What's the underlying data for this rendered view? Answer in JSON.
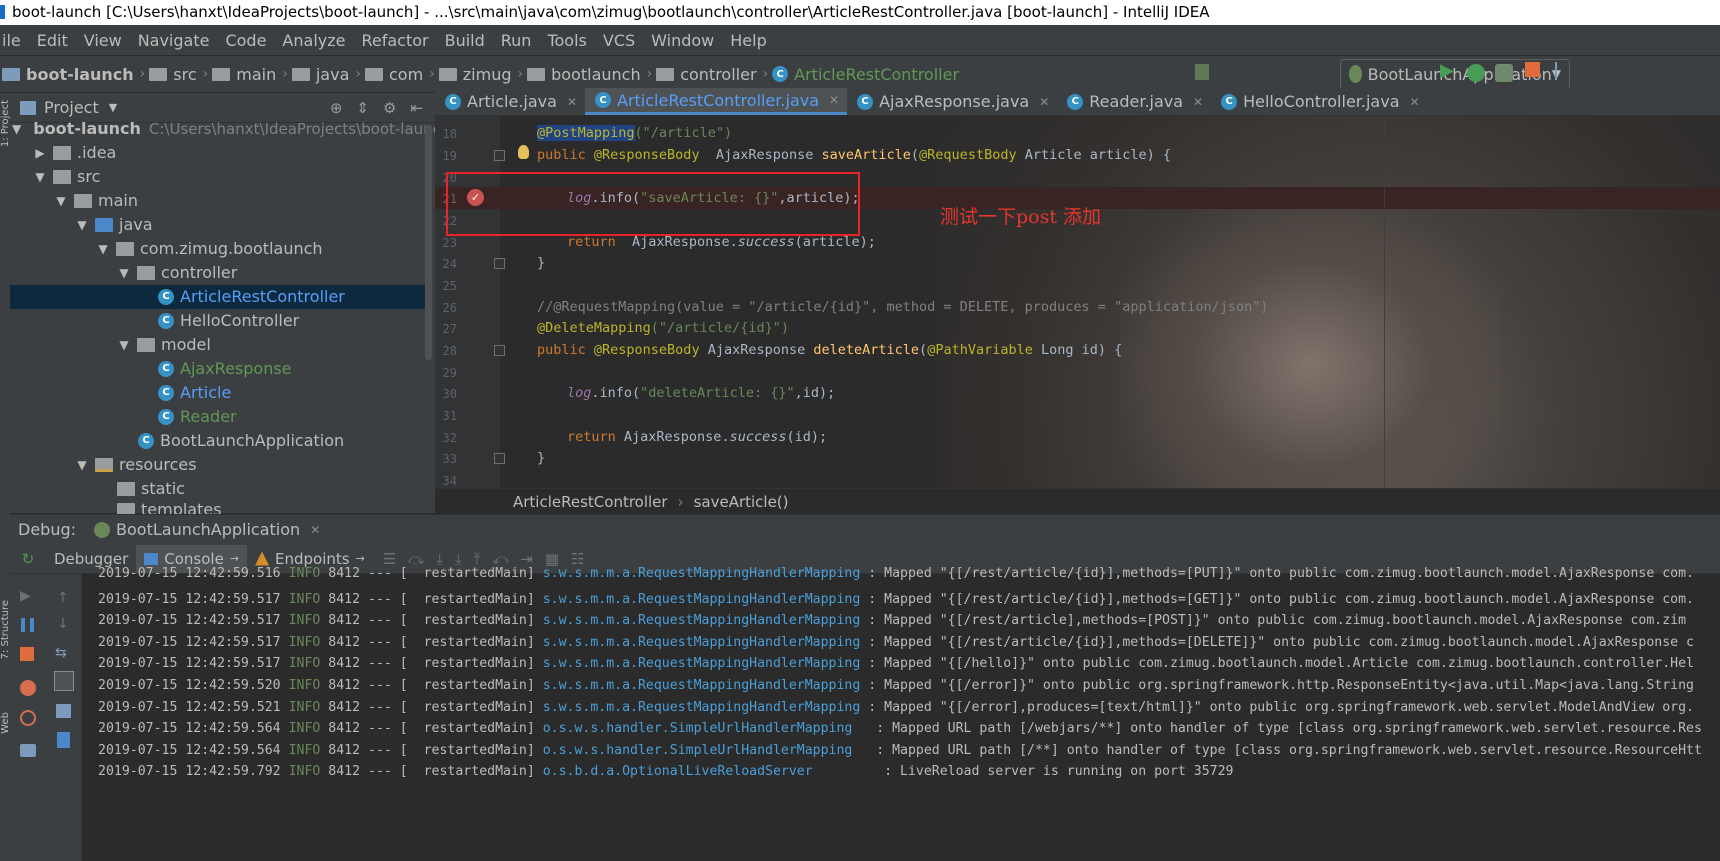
{
  "window_title": "boot-launch [C:\\Users\\hanxt\\IdeaProjects\\boot-launch] - ...\\src\\main\\java\\com\\zimug\\bootlaunch\\controller\\ArticleRestController.java [boot-launch] - IntelliJ IDEA",
  "menu": [
    "ile",
    "Edit",
    "View",
    "Navigate",
    "Code",
    "Analyze",
    "Refactor",
    "Build",
    "Run",
    "Tools",
    "VCS",
    "Window",
    "Help"
  ],
  "breadcrumbs": [
    "boot-launch",
    "src",
    "main",
    "java",
    "com",
    "zimug",
    "bootlaunch",
    "controller",
    "ArticleRestController"
  ],
  "run_config": "BootLaunchApplication",
  "project_panel": {
    "title": "Project",
    "tree": [
      {
        "label": "boot-launch",
        "path": "C:\\Users\\hanxt\\IdeaProjects\\boot-launch"
      },
      {
        "label": ".idea"
      },
      {
        "label": "src"
      },
      {
        "label": "main"
      },
      {
        "label": "java"
      },
      {
        "label": "com.zimug.bootlaunch"
      },
      {
        "label": "controller"
      },
      {
        "label": "ArticleRestController"
      },
      {
        "label": "HelloController"
      },
      {
        "label": "model"
      },
      {
        "label": "AjaxResponse"
      },
      {
        "label": "Article"
      },
      {
        "label": "Reader"
      },
      {
        "label": "BootLaunchApplication"
      },
      {
        "label": "resources"
      },
      {
        "label": "static"
      },
      {
        "label": "templates"
      }
    ]
  },
  "editor_tabs": [
    "Article.java",
    "ArticleRestController.java",
    "AjaxResponse.java",
    "Reader.java",
    "HelloController.java"
  ],
  "line_numbers": [
    "18",
    "19",
    "20",
    "21",
    "22",
    "23",
    "24",
    "25",
    "26",
    "27",
    "28",
    "29",
    "30",
    "31",
    "32",
    "33",
    "34"
  ],
  "code": {
    "l18_ann": "@PostMapping",
    "l18_str": "(\"/article\")",
    "l19_pub": "public ",
    "l19_ann": "@ResponseBody ",
    "l19_type": " AjaxResponse ",
    "l19_fn": "saveArticle",
    "l19_p1": "(",
    "l19_ann2": "@RequestBody",
    "l19_rest": " Article article) {",
    "l21_log": "log",
    "l21_info": ".info(",
    "l21_str": "\"saveArticle: {}\"",
    "l21_rest": ",article);",
    "l23_ret": "return ",
    "l23_type": " AjaxResponse.",
    "l23_succ": "success",
    "l23_rest": "(article);",
    "l24": "}",
    "l26": "//@RequestMapping(value = \"/article/{id}\", method = DELETE, produces = \"application/json\")",
    "l27_ann": "@DeleteMapping",
    "l27_str": "(\"/article/{id}\")",
    "l28_pub": "public ",
    "l28_ann": "@ResponseBody",
    "l28_type": " AjaxResponse ",
    "l28_fn": "deleteArticle",
    "l28_p1": "(",
    "l28_ann2": "@PathVariable",
    "l28_rest": " Long id) {",
    "l30_log": "log",
    "l30_info": ".info(",
    "l30_str": "\"deleteArticle: {}\"",
    "l30_rest": ",id);",
    "l32_ret": "return ",
    "l32_type": "AjaxResponse.",
    "l32_succ": "success",
    "l32_rest": "(id);",
    "l33": "}"
  },
  "annotation_note": "测试一下post   添加",
  "editor_breadcrumb": [
    "ArticleRestController",
    "saveArticle()"
  ],
  "debug": {
    "label": "Debug:",
    "session": "BootLaunchApplication",
    "tabs": [
      "Debugger",
      "Console",
      "Endpoints"
    ]
  },
  "console_lines": [
    {
      "ts": "2019-07-15 12:42:59.516",
      "lvl": "INFO",
      "pid": "8412",
      "sep": "--- [",
      "thread": " restartedMain]",
      "logger": "s.w.s.m.m.a.RequestMappingHandlerMapping",
      "msg": ": Mapped \"{[/rest/article/{id}],methods=[PUT]}\" onto public com.zimug.bootlaunch.model.AjaxResponse com."
    },
    {
      "ts": "2019-07-15 12:42:59.517",
      "lvl": "INFO",
      "pid": "8412",
      "sep": "--- [",
      "thread": " restartedMain]",
      "logger": "s.w.s.m.m.a.RequestMappingHandlerMapping",
      "msg": ": Mapped \"{[/rest/article/{id}],methods=[GET]}\" onto public com.zimug.bootlaunch.model.AjaxResponse com."
    },
    {
      "ts": "2019-07-15 12:42:59.517",
      "lvl": "INFO",
      "pid": "8412",
      "sep": "--- [",
      "thread": " restartedMain]",
      "logger": "s.w.s.m.m.a.RequestMappingHandlerMapping",
      "msg": ": Mapped \"{[/rest/article],methods=[POST]}\" onto public com.zimug.bootlaunch.model.AjaxResponse com.zim"
    },
    {
      "ts": "2019-07-15 12:42:59.517",
      "lvl": "INFO",
      "pid": "8412",
      "sep": "--- [",
      "thread": " restartedMain]",
      "logger": "s.w.s.m.m.a.RequestMappingHandlerMapping",
      "msg": ": Mapped \"{[/rest/article/{id}],methods=[DELETE]}\" onto public com.zimug.bootlaunch.model.AjaxResponse c"
    },
    {
      "ts": "2019-07-15 12:42:59.517",
      "lvl": "INFO",
      "pid": "8412",
      "sep": "--- [",
      "thread": " restartedMain]",
      "logger": "s.w.s.m.m.a.RequestMappingHandlerMapping",
      "msg": ": Mapped \"{[/hello]}\" onto public com.zimug.bootlaunch.model.Article com.zimug.bootlaunch.controller.Hel"
    },
    {
      "ts": "2019-07-15 12:42:59.520",
      "lvl": "INFO",
      "pid": "8412",
      "sep": "--- [",
      "thread": " restartedMain]",
      "logger": "s.w.s.m.m.a.RequestMappingHandlerMapping",
      "msg": ": Mapped \"{[/error]}\" onto public org.springframework.http.ResponseEntity<java.util.Map<java.lang.String"
    },
    {
      "ts": "2019-07-15 12:42:59.521",
      "lvl": "INFO",
      "pid": "8412",
      "sep": "--- [",
      "thread": " restartedMain]",
      "logger": "s.w.s.m.m.a.RequestMappingHandlerMapping",
      "msg": ": Mapped \"{[/error],produces=[text/html]}\" onto public org.springframework.web.servlet.ModelAndView org."
    },
    {
      "ts": "2019-07-15 12:42:59.564",
      "lvl": "INFO",
      "pid": "8412",
      "sep": "--- [",
      "thread": " restartedMain]",
      "logger": "o.s.w.s.handler.SimpleUrlHandlerMapping ",
      "msg": " : Mapped URL path [/webjars/**] onto handler of type [class org.springframework.web.servlet.resource.Res"
    },
    {
      "ts": "2019-07-15 12:42:59.564",
      "lvl": "INFO",
      "pid": "8412",
      "sep": "--- [",
      "thread": " restartedMain]",
      "logger": "o.s.w.s.handler.SimpleUrlHandlerMapping ",
      "msg": " : Mapped URL path [/**] onto handler of type [class org.springframework.web.servlet.resource.ResourceHtt"
    },
    {
      "ts": "2019-07-15 12:42:59.792",
      "lvl": "INFO",
      "pid": "8412",
      "sep": "--- [",
      "thread": " restartedMain]",
      "logger": "o.s.b.d.a.OptionalLiveReloadServer      ",
      "msg": "  : LiveReload server is running on port 35729"
    }
  ],
  "side_labels": {
    "project": "1: Project",
    "structure": "7: Structure",
    "web": "Web"
  }
}
